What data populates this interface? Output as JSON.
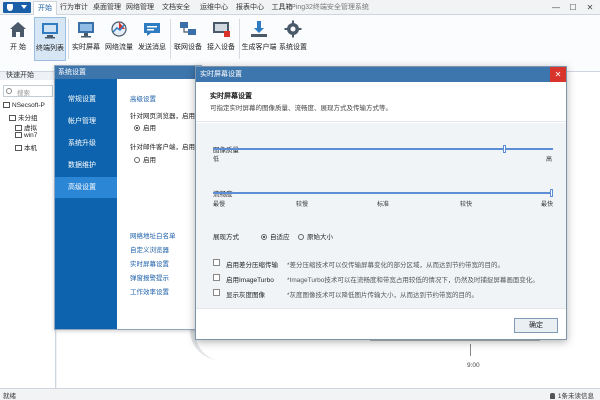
{
  "app": {
    "window_title": "Ping32终端安全管理系统",
    "window_controls": [
      "—",
      "☐",
      "✕"
    ]
  },
  "menu": {
    "tabs": [
      "开始",
      "行为审计",
      "桌面管理",
      "网络管理",
      "文档安全",
      "运维中心",
      "报表中心",
      "工具箱"
    ]
  },
  "ribbon": {
    "buttons": [
      "开 始",
      "终端列表",
      "实时屏幕",
      "网络流量",
      "发送消息",
      "联网设备",
      "接入设备",
      "生成客户端",
      "系统设置"
    ],
    "group_label": "快速开始"
  },
  "tree": {
    "search_placeholder": "搜索",
    "items": [
      "NSecsoft-P",
      "未分组",
      "虚拟",
      "win7",
      "本机"
    ]
  },
  "background": {
    "time_label": "9:00"
  },
  "status": {
    "left": "就绪",
    "right": "1条未读信息"
  },
  "system_dialog": {
    "title": "系统设置",
    "nav": [
      "常规设置",
      "帐户管理",
      "系统升级",
      "数据维护",
      "高级设置"
    ],
    "active_nav": "高级设置",
    "body": {
      "section_title": "高级设置",
      "browser_label": "针对网页浏览器，启用HT",
      "browser_radio": "启用",
      "mail_label": "针对邮件客户端，启用HT",
      "mail_radio": "启用",
      "links": [
        "网络地址白名单",
        "自定义浏览器",
        "实时屏幕设置",
        "弹窗报警提示",
        "工作效率设置"
      ]
    }
  },
  "screen_dialog": {
    "title": "实时屏幕设置",
    "close": "✕",
    "header_title": "实时屏幕设置",
    "header_desc": "可指定实时屏幕的图像质量、流畅度、展现方式及传输方式等。",
    "quality": {
      "label": "图像质量",
      "low": "低",
      "high": "高",
      "value": 0.86
    },
    "fluency": {
      "label": "流畅度",
      "ticks": [
        "最慢",
        "较慢",
        "标准",
        "较快",
        "最快"
      ],
      "value": 1.0
    },
    "display_mode": {
      "label": "展现方式",
      "options": [
        "自适应",
        "原始大小"
      ],
      "selected": "自适应"
    },
    "options": [
      {
        "label": "启用差分压缩传输",
        "desc": "*差分压缩技术可以仅传输屏幕变化的部分区域，从而达到节约带宽的目的。"
      },
      {
        "label": "启用ImageTurbo",
        "desc": "*ImageTurbo技术可以在流畅度和带宽占用较低的情况下，仍然及时捕捉屏幕画面变化。"
      },
      {
        "label": "显示灰度图像",
        "desc": "*灰度图像技术可以降低图片传输大小，从而达到节约带宽的目的。"
      }
    ],
    "ok_button": "确定"
  }
}
